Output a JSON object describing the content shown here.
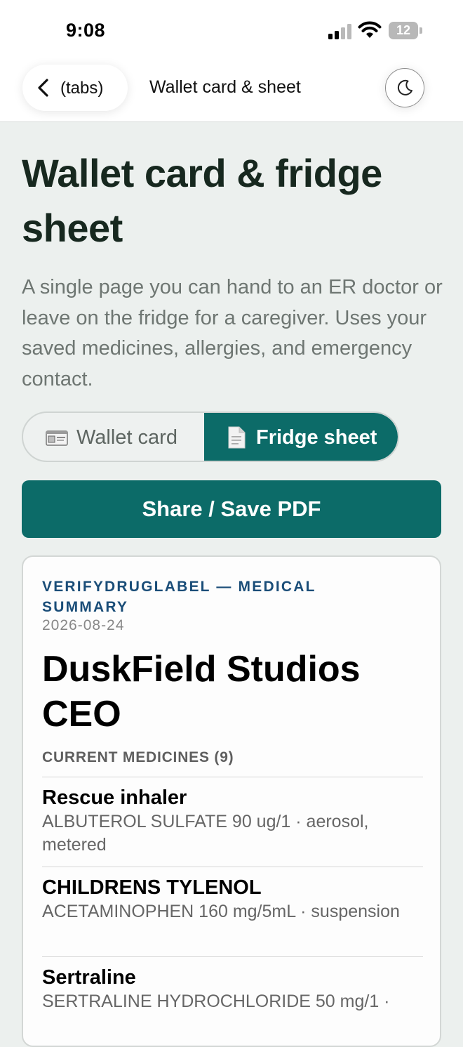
{
  "status_bar": {
    "time": "9:08",
    "battery": "12"
  },
  "nav": {
    "back_label": "(tabs)",
    "title": "Wallet card & sheet",
    "theme_icon": "moon-icon"
  },
  "header": {
    "title": "Wallet card & fridge sheet",
    "lead": "A single page you can hand to an ER doctor or leave on the fridge for a caregiver. Uses your saved medicines, allergies, and emergency contact."
  },
  "segmented": {
    "options": [
      {
        "label": "Wallet card",
        "icon": "id-card-icon",
        "selected": false
      },
      {
        "label": "Fridge sheet",
        "icon": "document-icon",
        "selected": true
      }
    ]
  },
  "actions": {
    "share_label": "Share / Save PDF"
  },
  "sheet": {
    "kicker": "VERIFYDRUGLABEL — MEDICAL SUMMARY",
    "date": "2026-08-24",
    "person": "DuskField Studios CEO",
    "medicines_label": "CURRENT MEDICINES (9)",
    "medicines": [
      {
        "name": "Rescue inhaler",
        "detail": "ALBUTEROL SULFATE 90 ug/1 · aerosol, metered"
      },
      {
        "name": "CHILDRENS TYLENOL",
        "detail": "ACETAMINOPHEN 160 mg/5mL · suspension"
      },
      {
        "name": "Sertraline",
        "detail": "SERTRALINE HYDROCHLORIDE 50 mg/1 ·"
      }
    ]
  },
  "colors": {
    "accent": "#0c6b68",
    "kicker": "#1a4d78",
    "background": "#ecf0ee"
  }
}
